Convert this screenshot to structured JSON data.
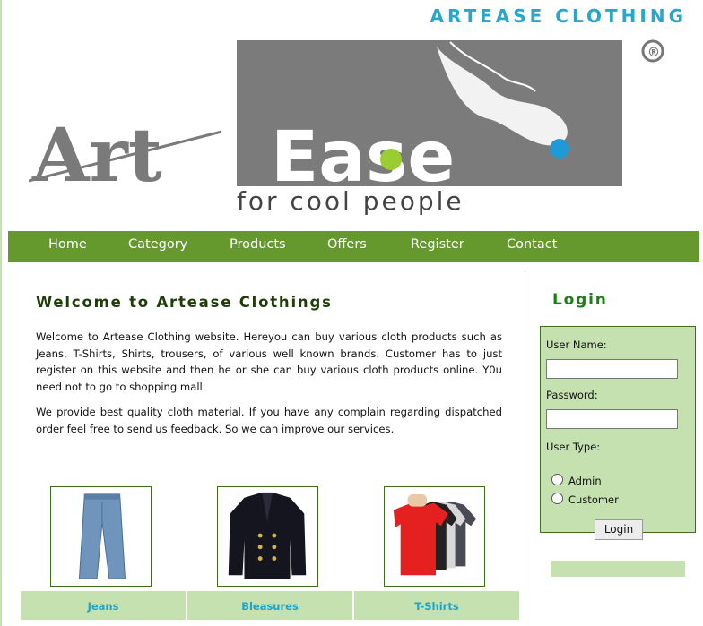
{
  "header": {
    "site_title": "ARTEASE CLOTHING",
    "logo_text_left": "Art",
    "logo_text_right": "Ease",
    "logo_tagline": "for cool people",
    "logo_mark": "®"
  },
  "nav": {
    "items": [
      {
        "label": "Home"
      },
      {
        "label": "Category"
      },
      {
        "label": "Products"
      },
      {
        "label": "Offers"
      },
      {
        "label": "Register"
      },
      {
        "label": "Contact"
      }
    ]
  },
  "main": {
    "title": "Welcome to Artease Clothings",
    "paragraph1": "Welcome to Artease Clothing website. Hereyou can buy various cloth products such as Jeans, T-Shirts, Shirts, trousers, of various well known brands. Customer has to just register on this website and then he or she can buy various cloth products online. Y0u need not to go to shopping mall.",
    "paragraph2": "We provide best quality cloth material. If you have any complain regarding dispatched order feel free to send us feedback. So we can improve our services.",
    "products": [
      {
        "label": "Jeans",
        "icon": "jeans-image"
      },
      {
        "label": "Bleasures",
        "icon": "blazer-image"
      },
      {
        "label": "T-Shirts",
        "icon": "tshirts-image"
      }
    ]
  },
  "login": {
    "title": "Login",
    "username_label": "User Name:",
    "username_value": "",
    "password_label": "Password:",
    "password_value": "",
    "usertype_label": "User Type:",
    "options": [
      "Admin",
      "Customer"
    ],
    "button_label": "Login"
  },
  "colors": {
    "accent_title": "#2aa5cc",
    "nav_bg": "#65992e",
    "panel_bg": "#c5e1b0",
    "heading_green": "#1e7d16"
  }
}
